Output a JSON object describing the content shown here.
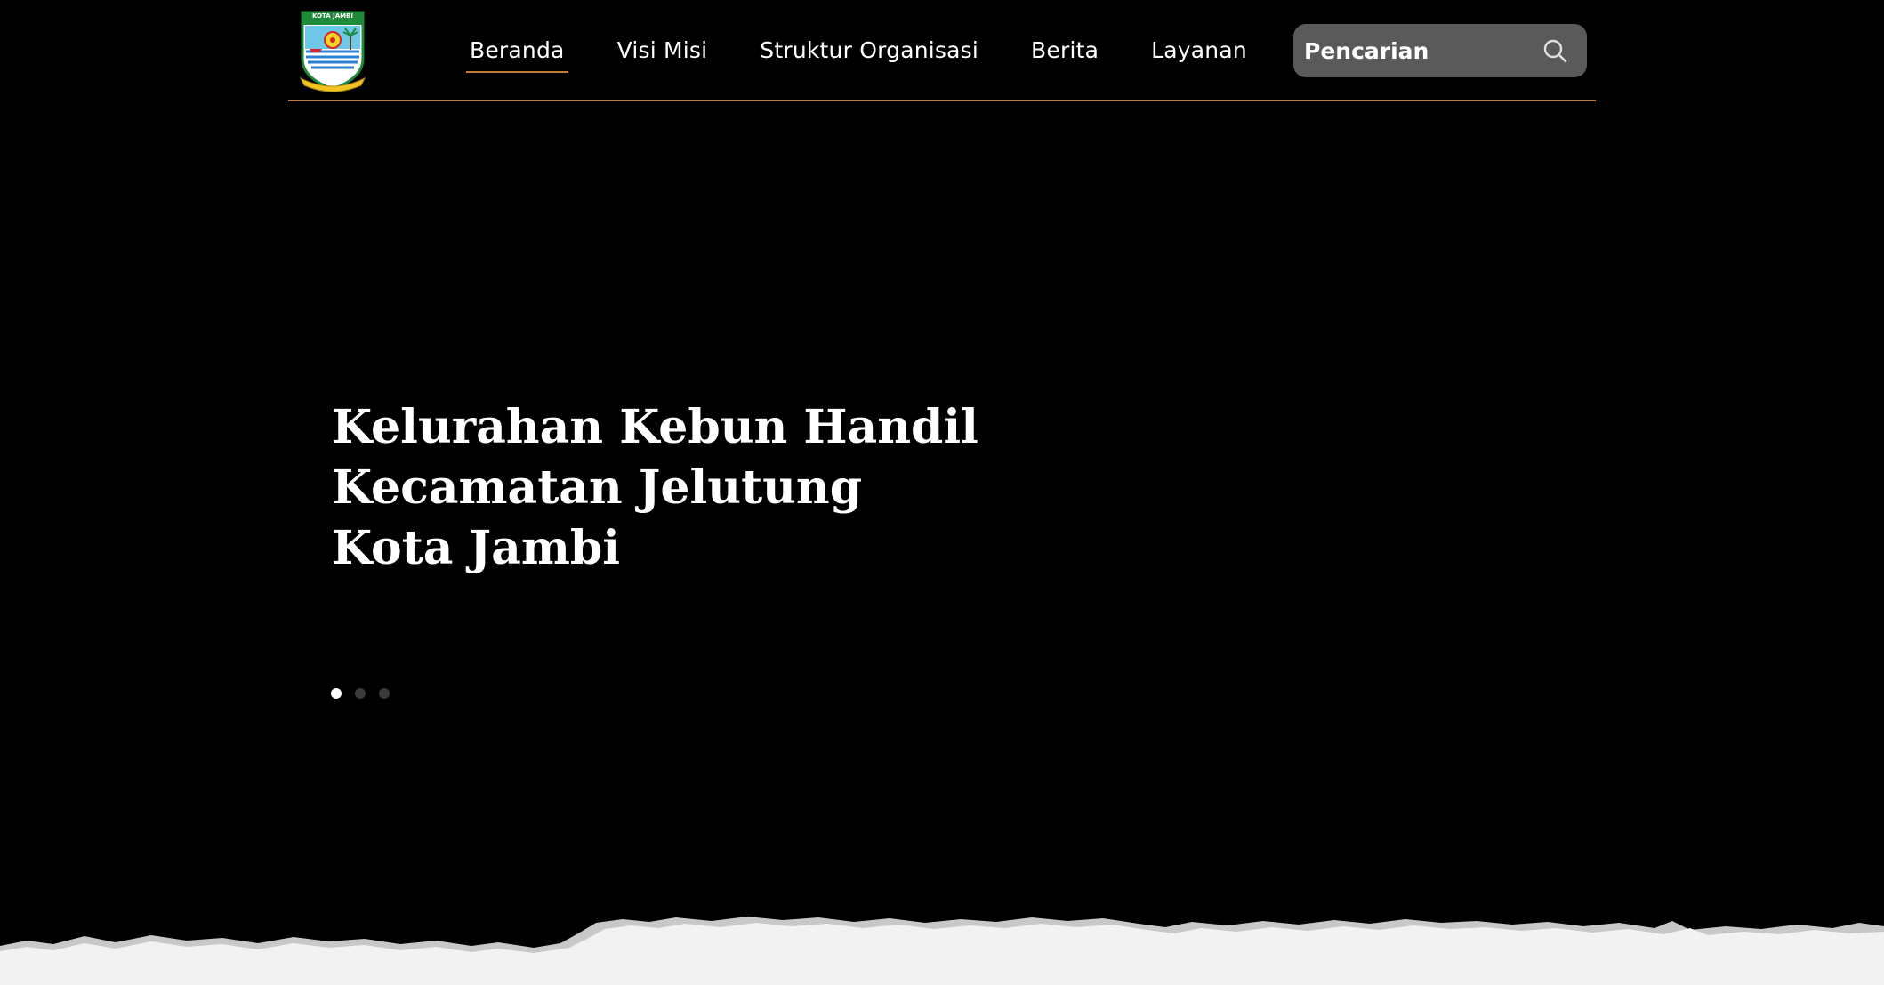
{
  "header": {
    "logo_text": "KOTA JAMBI",
    "nav": [
      {
        "label": "Beranda",
        "active": true
      },
      {
        "label": "Visi Misi",
        "active": false
      },
      {
        "label": "Struktur Organisasi",
        "active": false
      },
      {
        "label": "Berita",
        "active": false
      },
      {
        "label": "Layanan",
        "active": false
      }
    ],
    "search": {
      "placeholder": "Pencarian",
      "icon": "search-icon"
    }
  },
  "hero": {
    "title_lines": [
      "Kelurahan Kebun Handil",
      "Kecamatan Jelutung",
      "Kota Jambi"
    ],
    "carousel": {
      "slide_count": 3,
      "active_index": 0
    }
  },
  "colors": {
    "background": "#000000",
    "accent": "#c47a33",
    "search_bg": "#5a5a5a",
    "text": "#ffffff",
    "torn_paper": "#f2f2f2"
  }
}
